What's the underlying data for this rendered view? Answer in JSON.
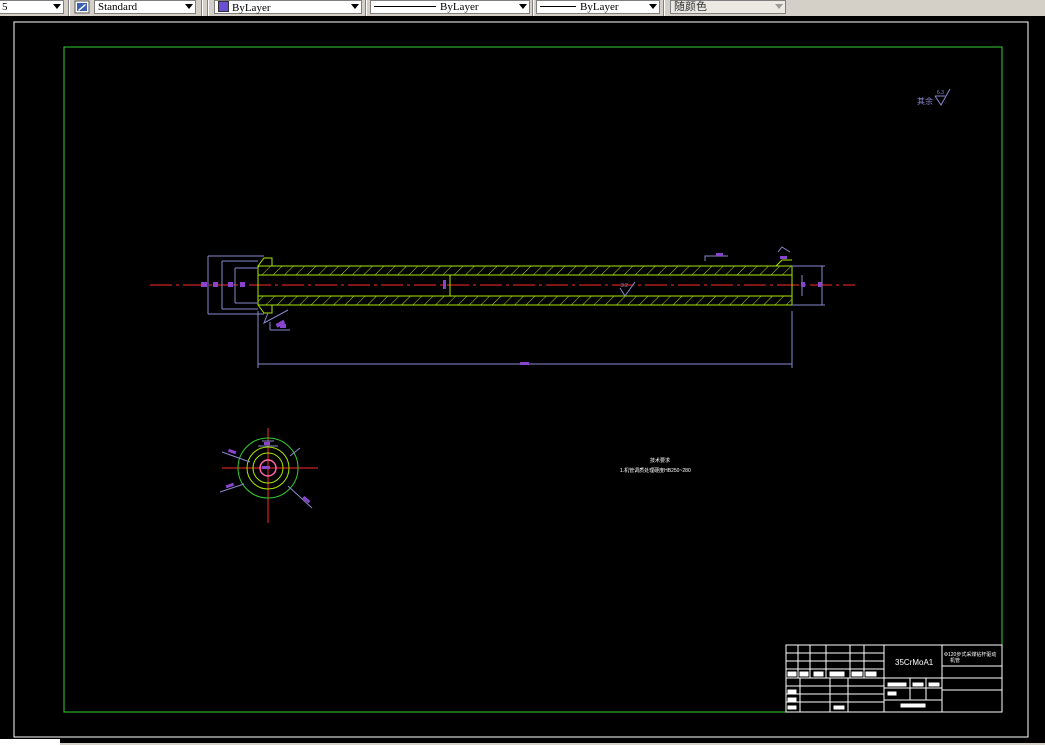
{
  "toolbar": {
    "layer_combo": {
      "value": "5"
    },
    "text_style": {
      "icon": "text-style-icon",
      "value": "Standard"
    },
    "color": {
      "value": "ByLayer",
      "swatch_color": "#6a4fd3"
    },
    "linetype": {
      "value": "ByLayer"
    },
    "lineweight": {
      "value": "ByLayer"
    },
    "plot_style": {
      "value": "随颜色"
    }
  },
  "drawing": {
    "background": "#000000",
    "border_color": "#33cc33",
    "hatch_color": "#a8e600",
    "dimension_color": "#8888cc",
    "centerline_color": "#ff2a2a",
    "text_color": "#ffffff",
    "marker_color": "#8844cc",
    "roughness_label": "其余",
    "roughness_value": "6.3",
    "roughness_mid_value": "3.2",
    "tech_req_title": "技术要求",
    "tech_req_line1": "1.机管调质处理硬度HB250~280",
    "title_block": {
      "material": "35CrMoA1",
      "drawing_name_line1": "Φ120步式采煤钻杆驱动",
      "drawing_name_line2": "机管"
    }
  }
}
